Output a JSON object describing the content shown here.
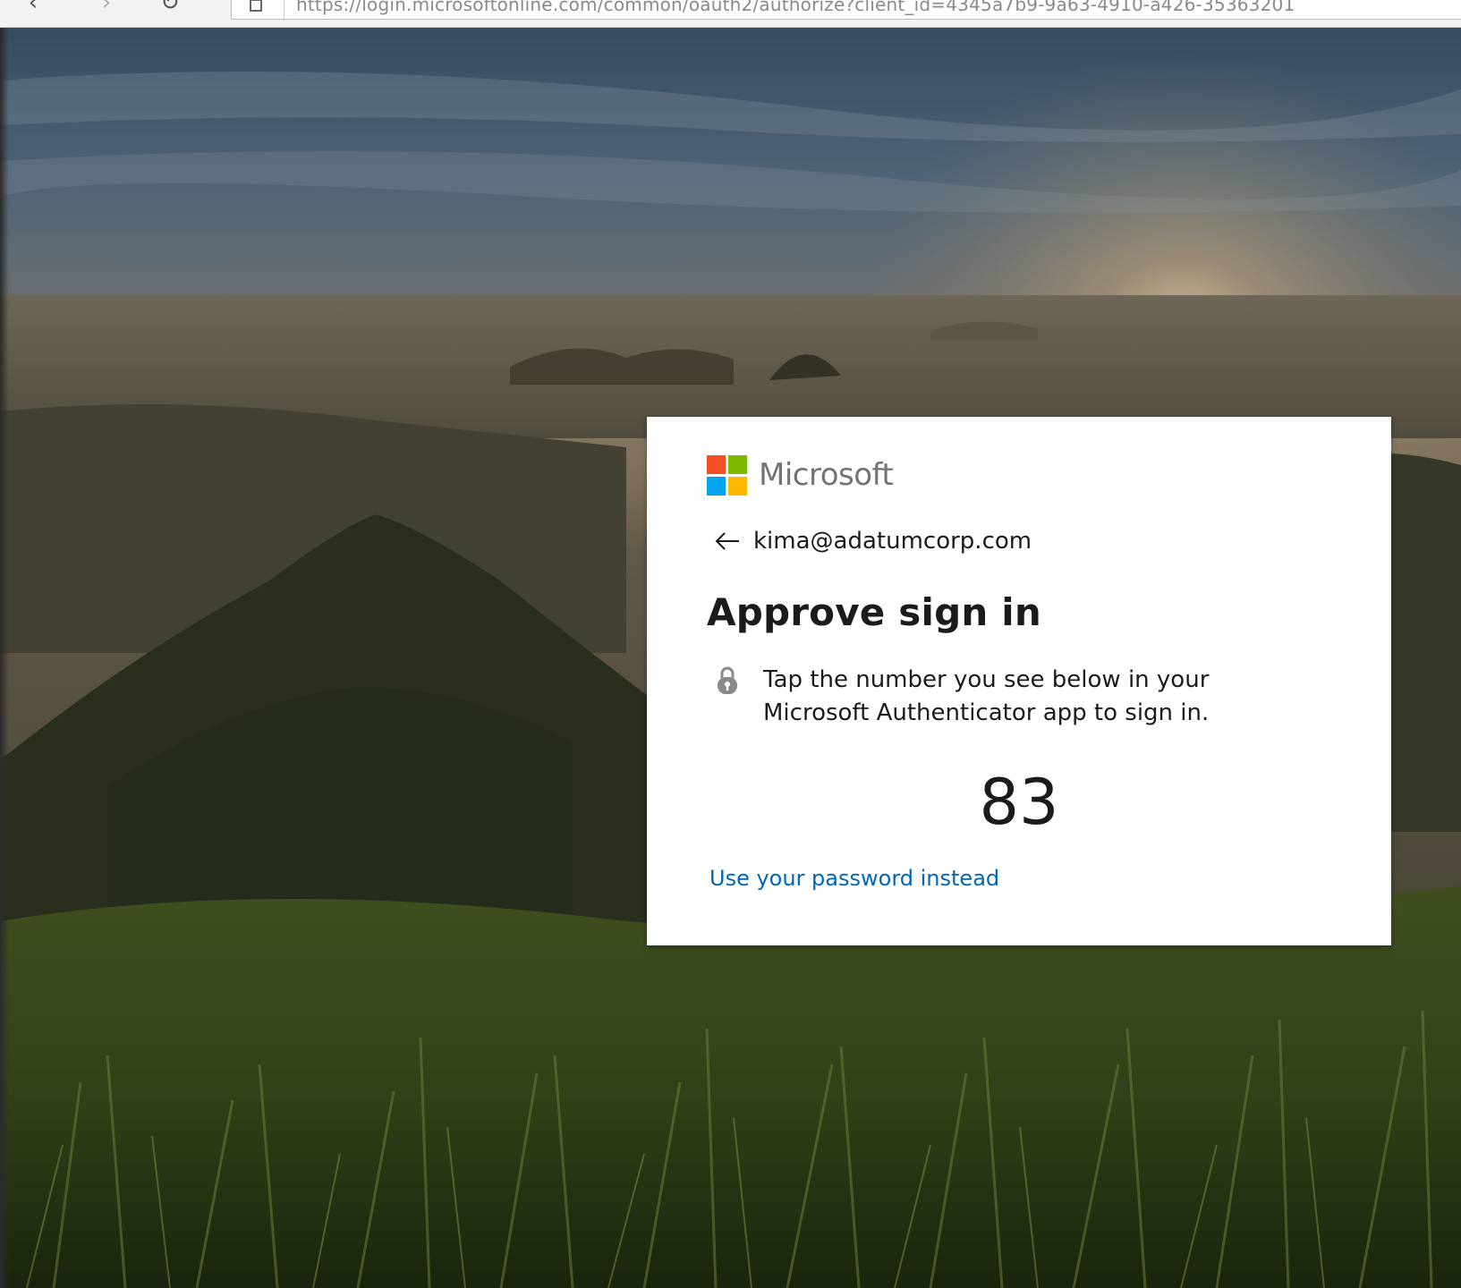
{
  "browser": {
    "address_url": "https://login.microsoftonline.com/common/oauth2/authorize?client_id=4345a7b9-9a63-4910-a426-35363201"
  },
  "card": {
    "brand_name": "Microsoft",
    "identity_email": "kima@adatumcorp.com",
    "title": "Approve sign in",
    "instruction": "Tap the number you see below in your Microsoft Authenticator app to sign in.",
    "display_number": "83",
    "alternate_link": "Use your password instead"
  },
  "colors": {
    "link": "#0067b8",
    "logo_red": "#f25022",
    "logo_green": "#7fba00",
    "logo_blue": "#00a4ef",
    "logo_yellow": "#ffb900"
  },
  "icons": {
    "back": "back-arrow-icon",
    "lock": "lock-icon",
    "logo": "microsoft-logo-icon"
  }
}
